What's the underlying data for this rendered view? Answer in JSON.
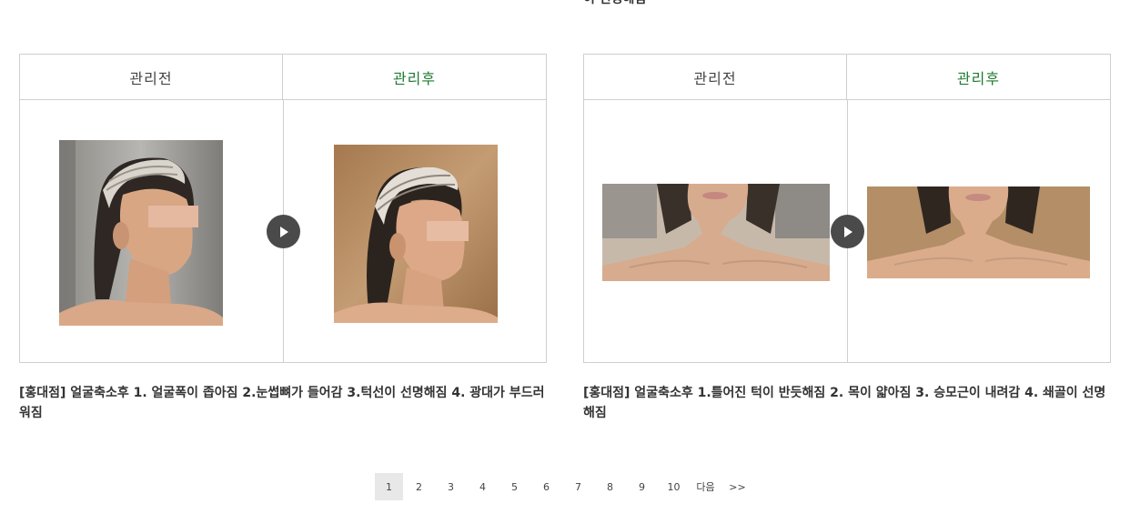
{
  "top_fragment": "이 선명해짐",
  "cases": [
    {
      "before_label": "관리전",
      "after_label": "관리후",
      "caption": "[홍대점] 얼굴축소후 1. 얼굴폭이 좁아짐 2.눈썹뼈가 들어감 3.턱선이 선명해짐 4. 광대가 부드러워짐"
    },
    {
      "before_label": "관리전",
      "after_label": "관리후",
      "caption": "[홍대점] 얼굴축소후 1.틀어진 턱이 반듯해짐 2. 목이 얇아짐 3. 승모근이 내려감 4. 쇄골이 선명해짐"
    }
  ],
  "pagination": {
    "pages": [
      "1",
      "2",
      "3",
      "4",
      "5",
      "6",
      "7",
      "8",
      "9",
      "10"
    ],
    "current": "1",
    "next_label": "다음",
    "last_label": ">>"
  },
  "colors": {
    "after_label": "#1c7a2f",
    "border": "#cfcfcf",
    "arrow_button": "#4a4a4a",
    "active_page_bg": "#e8e8e8"
  },
  "icons": {
    "arrow": "play-arrow-icon"
  }
}
